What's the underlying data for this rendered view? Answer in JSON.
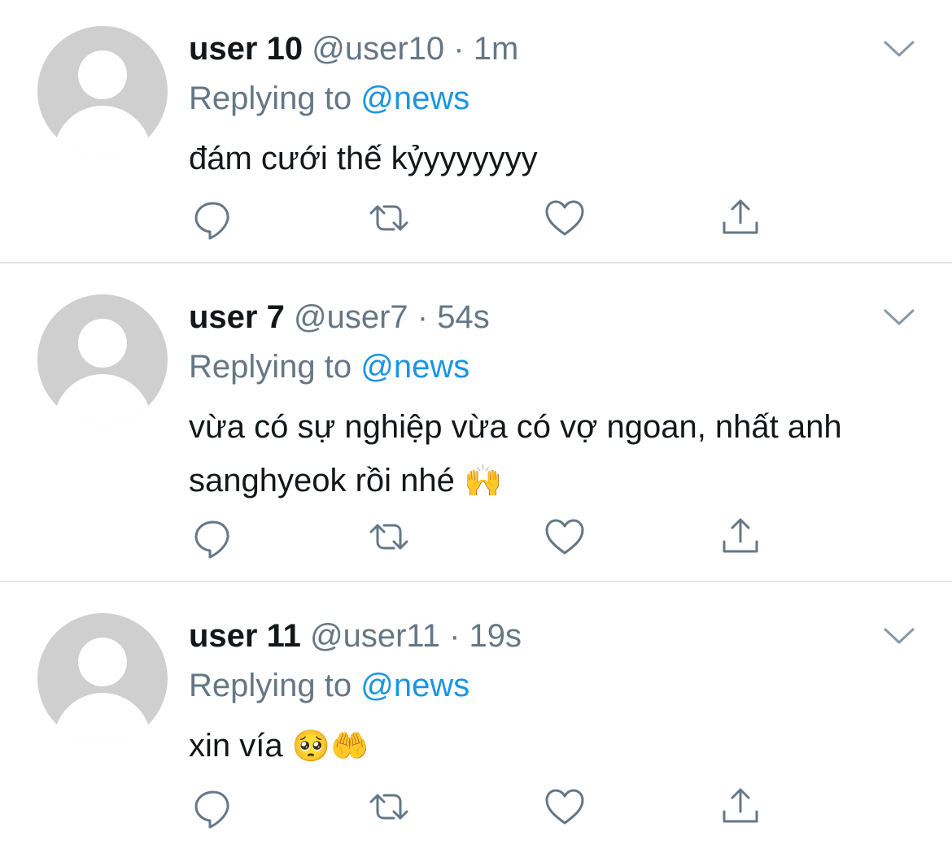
{
  "tweets": [
    {
      "display_name": "user 10",
      "handle": "@user10",
      "separator": "·",
      "time": "1m",
      "replying_prefix": "Replying to",
      "replying_to": "@news",
      "text": "đám cưới thế kỷyyyyyyy",
      "emoji": ""
    },
    {
      "display_name": "user 7",
      "handle": "@user7",
      "separator": "·",
      "time": "54s",
      "replying_prefix": "Replying to",
      "replying_to": "@news",
      "text": "vừa có sự nghiệp vừa có vợ ngoan, nhất anh sanghyeok rồi nhé",
      "emoji": "🙌"
    },
    {
      "display_name": "user 11",
      "handle": "@user11",
      "separator": "·",
      "time": "19s",
      "replying_prefix": "Replying to",
      "replying_to": "@news",
      "text": "xin vía",
      "emoji": "🥺🤲"
    }
  ],
  "icons": {
    "more": "chevron-down-icon",
    "reply": "reply-icon",
    "retweet": "retweet-icon",
    "like": "heart-icon",
    "share": "share-icon"
  },
  "colors": {
    "text": "#14171a",
    "secondary": "#657786",
    "mention": "#1b95e0",
    "avatar": "#cfcfcf",
    "divider": "#e1e8ed"
  }
}
